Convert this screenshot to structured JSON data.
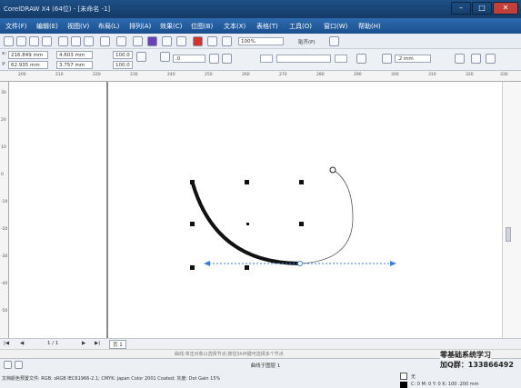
{
  "app": {
    "title": "CorelDRAW X4 (64位) - [未命名 -1]"
  },
  "menu": [
    "文件(F)",
    "编辑(E)",
    "视图(V)",
    "布局(L)",
    "排列(A)",
    "效果(C)",
    "位图(B)",
    "文本(X)",
    "表格(T)",
    "工具(O)",
    "窗口(W)",
    "帮助(H)"
  ],
  "standard_toolbar": {
    "zoom": "100%",
    "snap": "贴齐(P)"
  },
  "property_bar": {
    "x": "216.849 mm",
    "y": "62.935 mm",
    "w": "4.603 mm",
    "h": "3.757 mm",
    "scale_x": "100.0",
    "scale_y": "100.0",
    "angle": ".0",
    "outline": ".2 mm"
  },
  "ruler": {
    "h": [
      "200",
      "210",
      "220",
      "230",
      "240",
      "250",
      "260",
      "270",
      "280",
      "290",
      "300",
      "310",
      "320",
      "330"
    ],
    "v": [
      "30",
      "20",
      "10",
      "0",
      "-10",
      "-20",
      "-30",
      "-40",
      "-50"
    ]
  },
  "doc_nav": {
    "page": "1 / 1",
    "tab": "页 1"
  },
  "status": {
    "hint": "曲线:单击对象以选择节点;按住Shift键可选择多个节点",
    "object": "曲线于图层 1",
    "profile": "文档颜色预置文件: RGB: sRGB IEC61966-2.1; CMYK: Japan Color 2001 Coated; 灰度: Dot Gain 15%",
    "fill": "无",
    "outline": "C: 0 M: 0 Y: 0 K: 100  .200 mm"
  },
  "watermark": {
    "line1": "零基础系统学习",
    "line2": "加Q群：133866492"
  },
  "colors": {
    "titlebar": "#1d4f86",
    "menubar": "#2c6bb0",
    "guide": "#3b7fd6"
  }
}
